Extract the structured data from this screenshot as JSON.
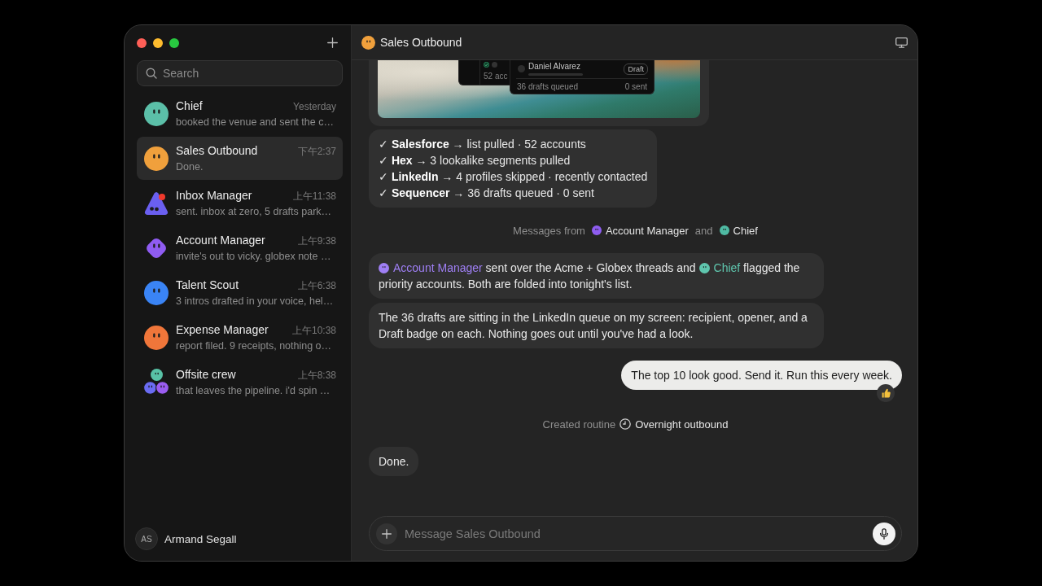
{
  "sidebar": {
    "search": {
      "placeholder": "Search"
    },
    "chats": [
      {
        "name": "Chief",
        "time": "Yesterday",
        "preview": "booked the venue and sent the c…",
        "kind": "circle",
        "color": "#5bbfa8",
        "unread": false,
        "selected": false
      },
      {
        "name": "Sales Outbound",
        "time": "下午2:37",
        "preview": "Done.",
        "kind": "circle",
        "color": "#f0a03c",
        "unread": false,
        "selected": true
      },
      {
        "name": "Inbox Manager",
        "time": "上午11:38",
        "preview": "sent. inbox at zero, 5 drafts park…",
        "kind": "triangle",
        "color": "#6a5ff0",
        "unread": true,
        "selected": false
      },
      {
        "name": "Account Manager",
        "time": "上午9:38",
        "preview": "invite's out to vicky. globex note …",
        "kind": "diamond",
        "color": "#8f5cf2",
        "unread": false,
        "selected": false
      },
      {
        "name": "Talent Scout",
        "time": "上午6:38",
        "preview": "3 intros drafted in your voice, hel…",
        "kind": "circle",
        "color": "#3a84f5",
        "unread": false,
        "selected": false
      },
      {
        "name": "Expense Manager",
        "time": "上午10:38",
        "preview": "report filed. 9 receipts, nothing o…",
        "kind": "circle",
        "color": "#f0763a",
        "unread": false,
        "selected": false
      },
      {
        "name": "Offsite crew",
        "time": "上午8:38",
        "preview": "that leaves the pipeline. i'd spin …",
        "kind": "group",
        "members": [
          {
            "color": "#58c2a6"
          },
          {
            "color": "#6a6cf2"
          },
          {
            "color": "#9a5cf0"
          }
        ],
        "unread": false,
        "selected": false
      }
    ],
    "user": {
      "initials": "AS",
      "name": "Armand Segall"
    }
  },
  "conversation": {
    "title": "Sales Outbound",
    "messages": [
      {
        "kind": "image",
        "screen": {
          "checked": true,
          "count": "52 acc",
          "row_name": "Daniel Alvarez",
          "row_badge": "Draft",
          "queued": "36 drafts queued",
          "sent": "0 sent"
        }
      },
      {
        "kind": "checklist",
        "lines": [
          "✓ **Salesforce** → list pulled · 52 accounts",
          "✓ **Hex** → 3 lookalike segments pulled",
          "✓ **LinkedIn** → 4 profiles skipped · recently contacted",
          "✓ **Sequencer** → 36 drafts queued · 0 sent"
        ]
      },
      {
        "kind": "participants",
        "label": "Messages from",
        "joiner": "and",
        "members": [
          {
            "name": "Account Manager",
            "color": "#8e5df0"
          },
          {
            "name": "Chief",
            "color": "#4fbaa3"
          }
        ]
      },
      {
        "kind": "text",
        "outgoing": false,
        "reaction": false,
        "segments": [
          {
            "kind": "mention",
            "name": "Account Manager",
            "color": "#9f7ff5"
          },
          {
            "kind": "plain",
            "text": " sent over the Acme + Globex threads and "
          },
          {
            "kind": "mention",
            "name": "Chief",
            "color": "#5fc6ae"
          },
          {
            "kind": "plain",
            "text": " flagged the priority accounts. Both are folded into tonight's list."
          }
        ]
      },
      {
        "kind": "text",
        "outgoing": false,
        "reaction": false,
        "segments": [
          {
            "kind": "plain",
            "text": "The 36 drafts are sitting in the LinkedIn queue on my screen: recipient, opener, and a Draft badge on each. Nothing goes out until you've had a look."
          }
        ]
      },
      {
        "kind": "text",
        "outgoing": true,
        "reaction": true,
        "segments": [
          {
            "kind": "plain",
            "text": "The top 10 look good. Send it. Run this every week."
          }
        ]
      },
      {
        "kind": "routine",
        "label": "Created routine",
        "name": "Overnight outbound"
      },
      {
        "kind": "text",
        "outgoing": false,
        "reaction": false,
        "segments": [
          {
            "kind": "plain",
            "text": "Done."
          }
        ]
      }
    ],
    "composer": {
      "placeholder": "Message Sales Outbound"
    }
  }
}
